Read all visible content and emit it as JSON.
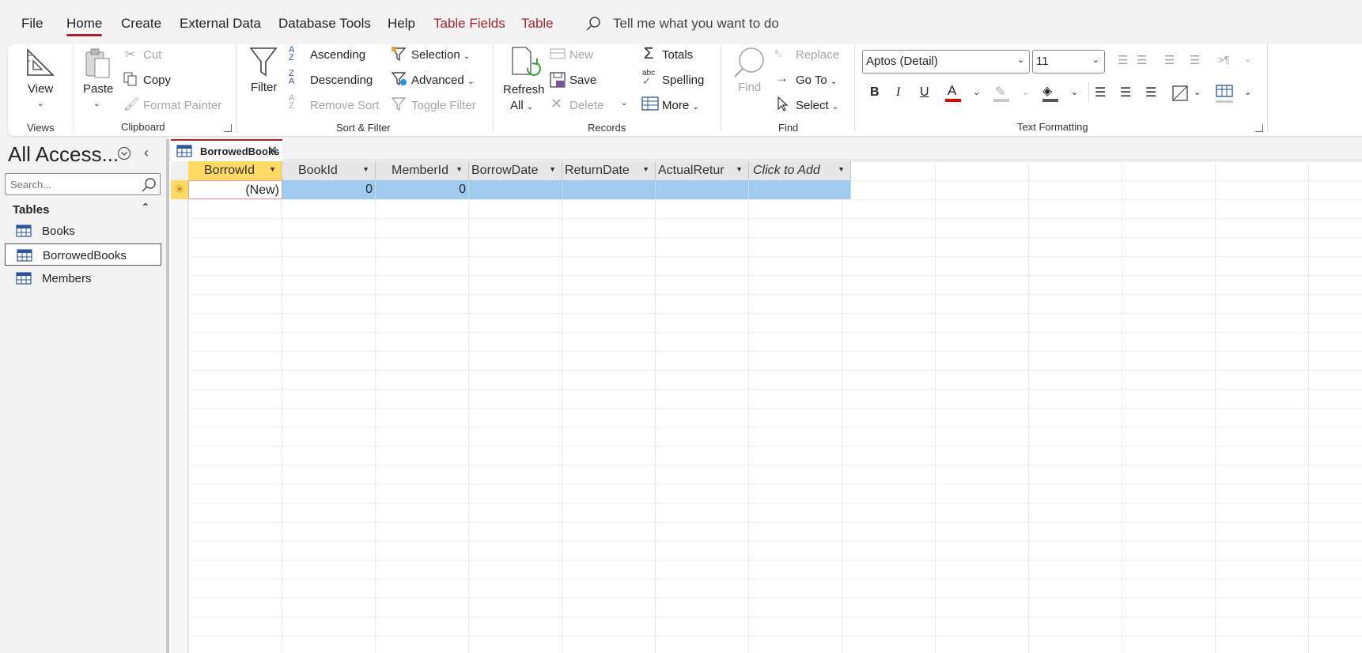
{
  "menu": {
    "tabs": [
      {
        "label": "File"
      },
      {
        "label": "Home"
      },
      {
        "label": "Create"
      },
      {
        "label": "External Data"
      },
      {
        "label": "Database Tools"
      },
      {
        "label": "Help"
      },
      {
        "label": "Table Fields"
      },
      {
        "label": "Table"
      }
    ],
    "active_tab": "Home",
    "tell_me": "Tell me what you want to do"
  },
  "ribbon": {
    "views": {
      "group": "Views",
      "view": "View"
    },
    "clipboard": {
      "group": "Clipboard",
      "paste": "Paste",
      "cut": "Cut",
      "copy": "Copy",
      "format_painter": "Format Painter"
    },
    "sort_filter": {
      "group": "Sort & Filter",
      "filter": "Filter",
      "ascending": "Ascending",
      "descending": "Descending",
      "remove_sort": "Remove Sort",
      "selection": "Selection",
      "advanced": "Advanced",
      "toggle_filter": "Toggle Filter"
    },
    "records": {
      "group": "Records",
      "refresh": "Refresh",
      "refresh_all": "All",
      "new": "New",
      "save": "Save",
      "delete": "Delete",
      "totals": "Totals",
      "spelling": "Spelling",
      "more": "More"
    },
    "find": {
      "group": "Find",
      "find": "Find",
      "replace": "Replace",
      "goto": "Go To",
      "select": "Select"
    },
    "text_formatting": {
      "group": "Text Formatting",
      "font": "Aptos (Detail)",
      "size": "11",
      "font_color": "#e00000"
    }
  },
  "nav": {
    "title": "All Access...",
    "search_placeholder": "Search...",
    "group": "Tables",
    "items": [
      {
        "label": "Books"
      },
      {
        "label": "BorrowedBooks"
      },
      {
        "label": "Members"
      }
    ],
    "selected": "BorrowedBooks"
  },
  "document": {
    "tab_label": "BorrowedBooks",
    "columns": [
      {
        "label": "BorrowId"
      },
      {
        "label": "BookId"
      },
      {
        "label": "MemberId"
      },
      {
        "label": "BorrowDate"
      },
      {
        "label": "ReturnDate"
      },
      {
        "label": "ActualRetur"
      },
      {
        "label": "Click to Add"
      }
    ],
    "new_row": {
      "borrow_id": "(New)",
      "book_id": "0",
      "member_id": "0"
    }
  }
}
